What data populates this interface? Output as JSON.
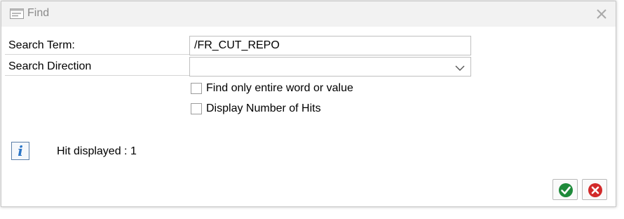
{
  "dialog": {
    "title": "Find",
    "search_term_label": "Search Term:",
    "search_term_value": "/FR_CUT_REPO",
    "search_direction_label": "Search Direction",
    "search_direction_value": "",
    "checkbox_entire_word_label": "Find only entire word or value",
    "checkbox_entire_word_checked": false,
    "checkbox_hits_label": "Display Number of Hits",
    "checkbox_hits_checked": false,
    "info_message": "Hit displayed : 1"
  },
  "icons": {
    "title": "find-dialog-icon",
    "close": "close-icon",
    "dropdown": "chevron-down-icon",
    "info": "info-icon",
    "confirm": "checkmark-icon",
    "cancel": "cancel-icon"
  },
  "colors": {
    "confirm": "#1e8a3a",
    "cancel": "#d22a2a",
    "info": "#2a74c6"
  }
}
